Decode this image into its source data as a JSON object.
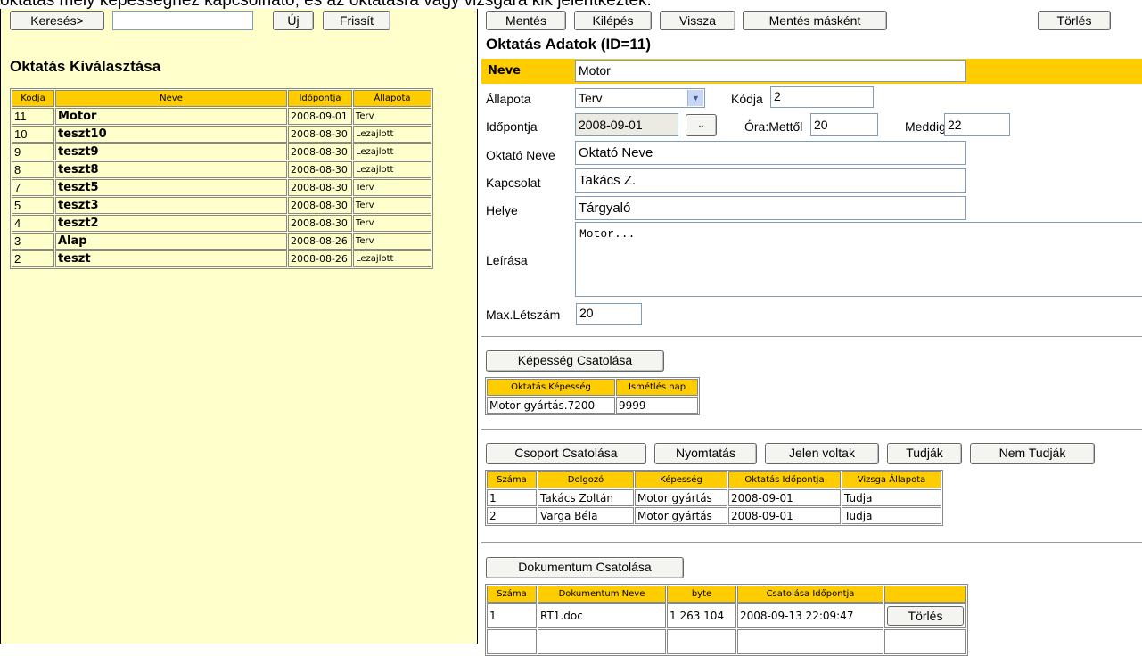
{
  "top_caption": "oktatás mely képességhez kapcsolhato, és az oktatásra vagy vizsgára kik jelentkeztek.",
  "left": {
    "search_button": "Keresés>",
    "search_value": "",
    "new_button": "Új",
    "refresh_button": "Frissít",
    "title": "Oktatás  Kiválasztása",
    "columns": [
      "Kódja",
      "Neve",
      "Időpontja",
      "Állapota"
    ],
    "rows": [
      {
        "code": "11",
        "name": "Motor",
        "date": "2008-09-01",
        "status": "Terv"
      },
      {
        "code": "10",
        "name": "teszt10",
        "date": "2008-08-30",
        "status": "Lezajlott"
      },
      {
        "code": "9",
        "name": "teszt9",
        "date": "2008-08-30",
        "status": "Lezajlott"
      },
      {
        "code": "8",
        "name": "teszt8",
        "date": "2008-08-30",
        "status": "Lezajlott"
      },
      {
        "code": "7",
        "name": "teszt5",
        "date": "2008-08-30",
        "status": "Terv"
      },
      {
        "code": "5",
        "name": "teszt3",
        "date": "2008-08-30",
        "status": "Terv"
      },
      {
        "code": "4",
        "name": "teszt2",
        "date": "2008-08-30",
        "status": "Terv"
      },
      {
        "code": "3",
        "name": "Alap",
        "date": "2008-08-26",
        "status": "Terv"
      },
      {
        "code": "2",
        "name": "teszt",
        "date": "2008-08-26",
        "status": "Lezajlott"
      }
    ]
  },
  "toolbar": {
    "save": "Mentés",
    "exit": "Kilépés",
    "back": "Vissza",
    "save_as": "Mentés másként",
    "delete": "Törlés"
  },
  "form": {
    "title": "Oktatás Adatok (ID=11)",
    "name_label": "Neve",
    "name_value": "Motor",
    "status_label": "Állapota",
    "status_value": "Terv",
    "code_label": "Kódja",
    "code_value": "2",
    "date_label": "Időpontja",
    "date_value": "2008-09-01",
    "date_button": "..",
    "from_label": "Óra:Mettől",
    "from_value": "20",
    "to_label": "Meddig",
    "to_value": "22",
    "instructor_label": "Oktató Neve",
    "instructor_value": "Oktató Neve",
    "contact_label": "Kapcsolat",
    "contact_value": "Takács Z.",
    "place_label": "Helye",
    "place_value": "Tárgyaló",
    "desc_label": "Leírása",
    "desc_value": "Motor...",
    "max_label": "Max.Létszám",
    "max_value": "20"
  },
  "skills": {
    "attach_button": "Képesség Csatolása",
    "columns": [
      "Oktatás Képesség",
      "Ismétlés nap"
    ],
    "rows": [
      {
        "skill": "Motor gyártás.7200",
        "repeat": "9999"
      }
    ]
  },
  "group": {
    "attach_button": "Csoport Csatolása",
    "print_button": "Nyomtatás",
    "present_button": "Jelen voltak",
    "know_button": "Tudják",
    "not_know_button": "Nem Tudják",
    "columns": [
      "Száma",
      "Dolgozó",
      "Képesség",
      "Oktatás Időpontja",
      "Vizsga Állapota"
    ],
    "rows": [
      {
        "num": "1",
        "worker": "Takács Zoltán",
        "skill": "Motor gyártás",
        "date": "2008-09-01",
        "exam": "Tudja"
      },
      {
        "num": "2",
        "worker": "Varga Béla",
        "skill": "Motor gyártás",
        "date": "2008-09-01",
        "exam": "Tudja"
      }
    ]
  },
  "docs": {
    "attach_button": "Dokumentum Csatolása",
    "columns": [
      "Száma",
      "Dokumentum  Neve",
      "byte",
      "Csatolása  Időpontja",
      ""
    ],
    "rows": [
      {
        "num": "1",
        "name": "RT1.doc",
        "bytes": "1 263 104",
        "date": "2008-09-13 22:09:47",
        "action": "Törlés"
      }
    ]
  }
}
